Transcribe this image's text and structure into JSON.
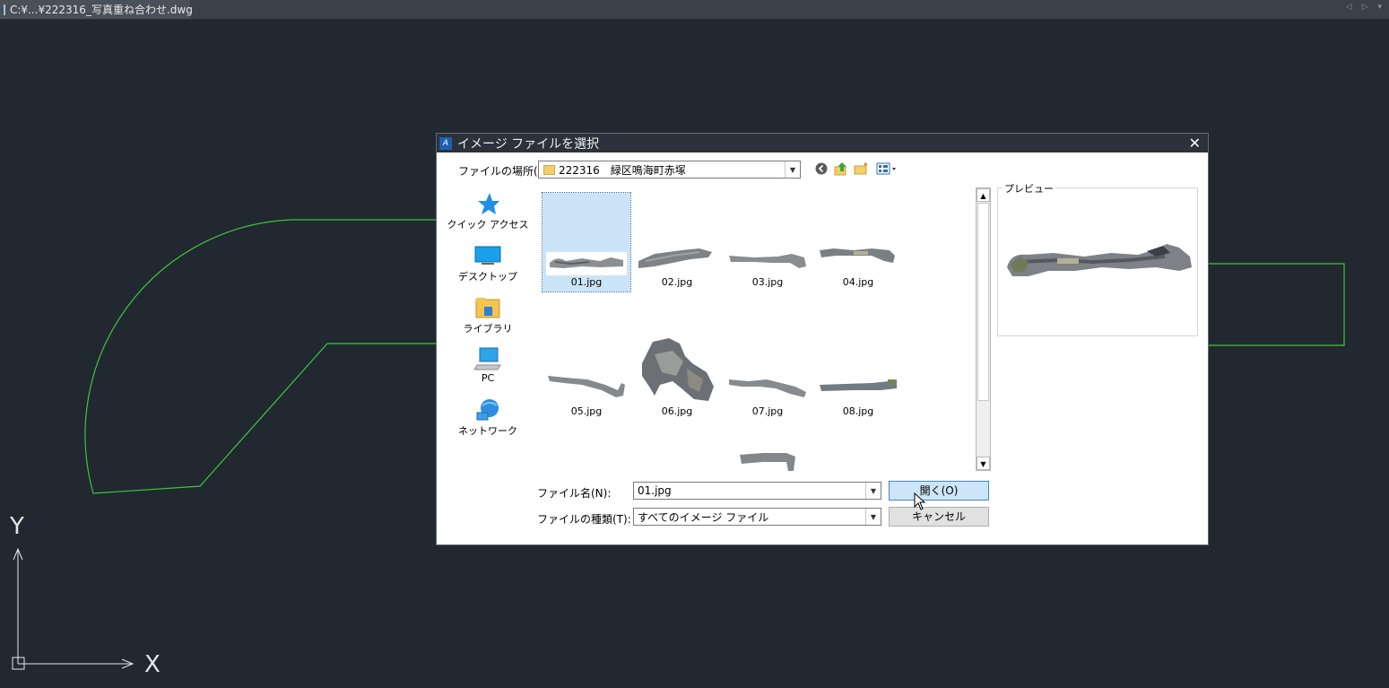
{
  "app": {
    "doc_tab_title": "C:¥...¥222316_写真重ね合わせ.dwg",
    "doc_tab_logo": "DWG",
    "tab_controls": "◁ ▷ ▾"
  },
  "canvas": {
    "background": "#212830",
    "line_color": "#3ec43e",
    "ucs": {
      "x_label": "X",
      "y_label": "Y"
    }
  },
  "dialog": {
    "title": "イメージ ファイルを選択",
    "close_glyph": "✕",
    "look_in": {
      "label": "ファイルの場所(I):",
      "value": "222316　緑区鳴海町赤塚"
    },
    "places": [
      {
        "label": "クイック アクセス",
        "icon": "star-icon"
      },
      {
        "label": "デスクトップ",
        "icon": "desktop-icon"
      },
      {
        "label": "ライブラリ",
        "icon": "library-icon"
      },
      {
        "label": "PC",
        "icon": "pc-icon"
      },
      {
        "label": "ネットワーク",
        "icon": "network-icon"
      }
    ],
    "files": [
      "01.jpg",
      "02.jpg",
      "03.jpg",
      "04.jpg",
      "05.jpg",
      "06.jpg",
      "07.jpg",
      "08.jpg"
    ],
    "selected_file": "01.jpg",
    "preview_label": "プレビュー",
    "filename": {
      "label": "ファイル名(N):",
      "value": "01.jpg"
    },
    "filetype": {
      "label": "ファイルの種類(T):",
      "value": "すべてのイメージ ファイル"
    },
    "open_button": "開く(O)",
    "cancel_button": "キャンセル",
    "accent_color": "#cde5f8"
  }
}
